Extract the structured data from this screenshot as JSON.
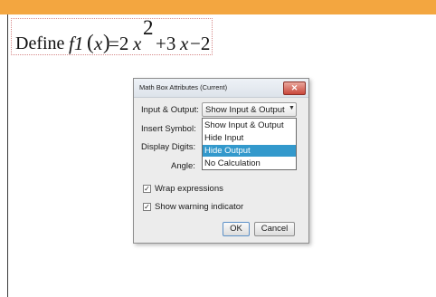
{
  "document": {
    "math_box": {
      "word": "Define",
      "func_name": "f1",
      "paren_open": "(",
      "var": "x",
      "paren_close": ")",
      "equals": "=2",
      "x1": "x",
      "exponent": "2",
      "plus": "+3",
      "x2": "x",
      "minus": "−2"
    }
  },
  "dialog": {
    "title": "Math Box Attributes (Current)",
    "close_label": "✕",
    "labels": {
      "input_output": "Input & Output:",
      "insert_symbol": "Insert Symbol:",
      "display_digits": "Display Digits:",
      "angle": "Angle:"
    },
    "input_output_selected": "Show Input & Output",
    "dropdown_options": [
      {
        "label": "Show Input & Output",
        "selected": false
      },
      {
        "label": "Hide Input",
        "selected": false
      },
      {
        "label": "Hide Output",
        "selected": true
      },
      {
        "label": "No Calculation",
        "selected": false
      }
    ],
    "checkboxes": {
      "wrap_expressions": {
        "label": "Wrap expressions",
        "checked": true
      },
      "show_warning": {
        "label": "Show warning indicator",
        "checked": true
      }
    },
    "buttons": {
      "ok": "OK",
      "cancel": "Cancel"
    }
  },
  "colors": {
    "top_bar": "#f3a640",
    "selection": "#3399cc",
    "close_button": "#c9473b"
  }
}
